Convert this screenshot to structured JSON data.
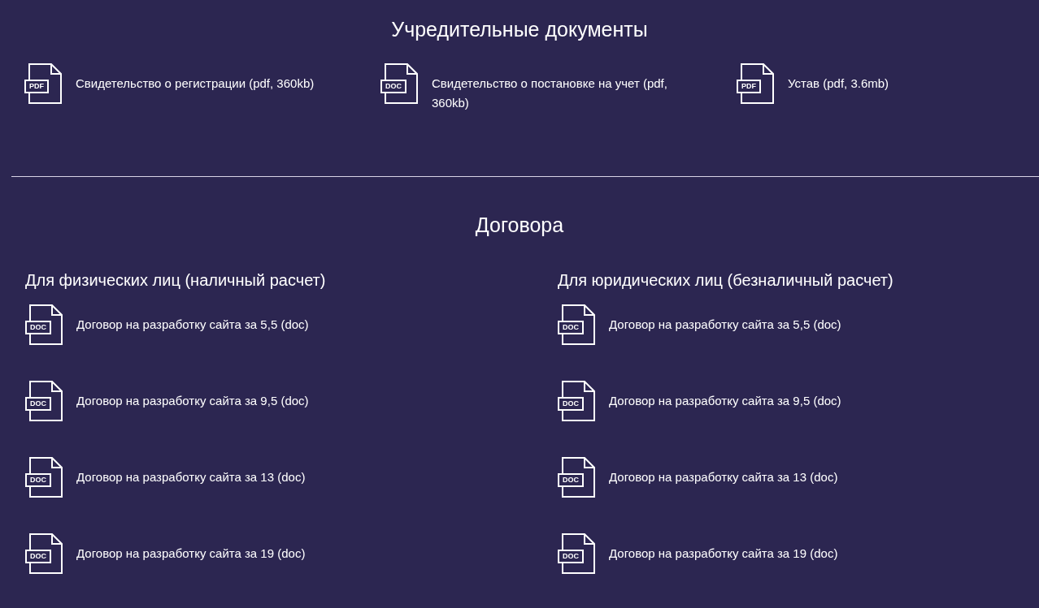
{
  "founding": {
    "title": "Учредительные документы",
    "files": [
      {
        "type": "PDF",
        "name": "Свидетельство о регистрации (pdf, 360kb)"
      },
      {
        "type": "DOC",
        "name": "Свидетельство о постановке на учет (pdf, 360kb)"
      },
      {
        "type": "PDF",
        "name": "Устав (pdf, 3.6mb)"
      }
    ]
  },
  "contracts": {
    "title": "Договора",
    "groups": [
      {
        "title": "Для физических лиц (наличный расчет)",
        "files": [
          {
            "type": "DOC",
            "name": "Договор на разработку сайта за 5,5 (doc)"
          },
          {
            "type": "DOC",
            "name": "Договор на разработку сайта за 9,5 (doc)"
          },
          {
            "type": "DOC",
            "name": "Договор на разработку сайта за 13 (doc)"
          },
          {
            "type": "DOC",
            "name": "Договор на разработку сайта за 19 (doc)"
          }
        ]
      },
      {
        "title": "Для юридических лиц (безналичный расчет)",
        "files": [
          {
            "type": "DOC",
            "name": "Договор на разработку сайта за 5,5 (doc)"
          },
          {
            "type": "DOC",
            "name": "Договор на разработку сайта за 9,5 (doc)"
          },
          {
            "type": "DOC",
            "name": "Договор на разработку сайта за 13 (doc)"
          },
          {
            "type": "DOC",
            "name": "Договор на разработку сайта за 19 (doc)"
          }
        ]
      }
    ]
  }
}
